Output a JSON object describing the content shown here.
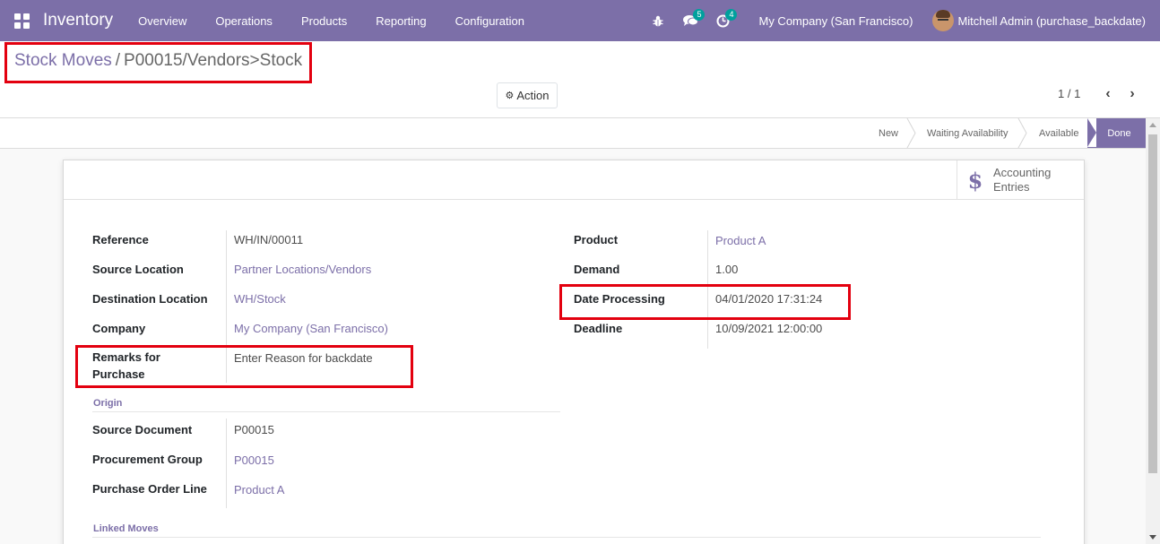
{
  "navbar": {
    "app_title": "Inventory",
    "menu": [
      "Overview",
      "Operations",
      "Products",
      "Reporting",
      "Configuration"
    ],
    "messages_count": "5",
    "activities_count": "4",
    "company": "My Company (San Francisco)",
    "user": "Mitchell Admin (purchase_backdate)"
  },
  "breadcrumb": {
    "parent": "Stock Moves",
    "separator": "/",
    "current": "P00015/Vendors>Stock"
  },
  "action_label": "Action",
  "pager": {
    "text": "1 / 1"
  },
  "statusbar": {
    "stages": [
      "New",
      "Waiting Availability",
      "Available",
      "Done"
    ],
    "active": "Done"
  },
  "smart_button": {
    "label_line1": "Accounting",
    "label_line2": "Entries"
  },
  "left_fields": [
    {
      "label": "Reference",
      "value": "WH/IN/00011"
    },
    {
      "label": "Source Location",
      "value": "Partner Locations/Vendors"
    },
    {
      "label": "Destination Location",
      "value": "WH/Stock"
    },
    {
      "label": "Company",
      "value": "My Company (San Francisco)"
    },
    {
      "label_line1": "Remarks for",
      "label_line2": "Purchase",
      "value": "Enter Reason for backdate"
    }
  ],
  "right_fields": [
    {
      "label": "Product",
      "value": "Product A"
    },
    {
      "label": "Demand",
      "value": "1.00"
    },
    {
      "label": "Date Processing",
      "value": "04/01/2020 17:31:24"
    },
    {
      "label": "Deadline",
      "value": "10/09/2021 12:00:00"
    }
  ],
  "origin": {
    "title": "Origin",
    "fields": [
      {
        "label": "Source Document",
        "value": "P00015"
      },
      {
        "label": "Procurement Group",
        "value": "P00015"
      },
      {
        "label": "Purchase Order Line",
        "value": "Product A"
      }
    ]
  },
  "linked_moves_title": "Linked Moves",
  "colors": {
    "brand": "#7c6fa8",
    "badge": "#00a09d",
    "highlight": "#e3000f"
  }
}
